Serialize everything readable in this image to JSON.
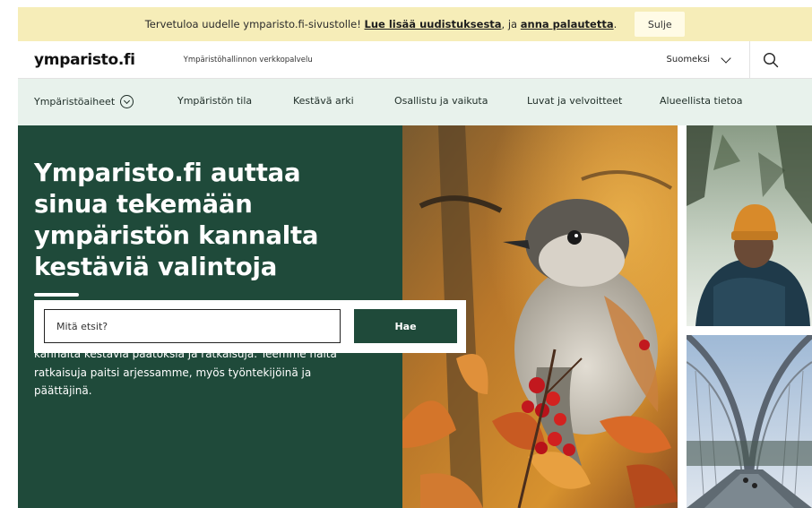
{
  "banner": {
    "text_before": "Tervetuloa uudelle ymparisto.fi-sivustolle!",
    "link1": "Lue lisää uudistuksesta",
    "middle": ", ja",
    "link2": "anna palautetta",
    "end": ".",
    "close_label": "Sulje"
  },
  "header": {
    "logo": "ymparisto.fi",
    "tagline": "Ympäristöhallinnon verkkopalvelu",
    "language": "Suomeksi",
    "search_icon": "search-icon"
  },
  "nav": {
    "items": [
      {
        "label": "Ympäristöaiheet",
        "icon": "chevron-circle-icon"
      },
      {
        "label": "Ympäristön tila"
      },
      {
        "label": "Kestävä arki"
      },
      {
        "label": "Osallistu ja vaikuta"
      },
      {
        "label": "Luvat ja velvoitteet"
      },
      {
        "label": "Alueellista tietoa"
      }
    ]
  },
  "hero": {
    "title": "Ymparisto.fi auttaa sinua tekemään ympäristön kannalta kestäviä valintoja",
    "body": "Ymparisto.fi-sivustolla julkaistaan tietoa, joka auttaa ja kannustaa meitä suomalaisia tekemään ympäristön kannalta kestäviä päätöksiä ja ratkaisuja. Teemme näitä ratkaisuja paitsi arjessamme, myös työntekijöinä ja päättäjinä.",
    "search_placeholder": "Mitä etsit?",
    "search_button": "Hae"
  },
  "colors": {
    "banner_bg": "#f6edb8",
    "nav_bg": "#e8f2ec",
    "hero_bg": "#1f4a3a",
    "accent": "#1f4a3a"
  }
}
